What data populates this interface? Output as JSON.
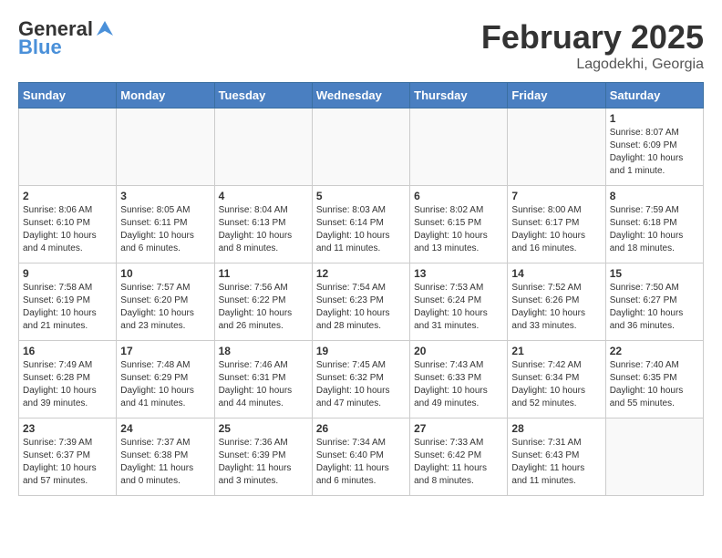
{
  "header": {
    "logo_line1": "General",
    "logo_line2": "Blue",
    "month": "February 2025",
    "location": "Lagodekhi, Georgia"
  },
  "weekdays": [
    "Sunday",
    "Monday",
    "Tuesday",
    "Wednesday",
    "Thursday",
    "Friday",
    "Saturday"
  ],
  "weeks": [
    [
      {
        "day": "",
        "info": ""
      },
      {
        "day": "",
        "info": ""
      },
      {
        "day": "",
        "info": ""
      },
      {
        "day": "",
        "info": ""
      },
      {
        "day": "",
        "info": ""
      },
      {
        "day": "",
        "info": ""
      },
      {
        "day": "1",
        "info": "Sunrise: 8:07 AM\nSunset: 6:09 PM\nDaylight: 10 hours and 1 minute."
      }
    ],
    [
      {
        "day": "2",
        "info": "Sunrise: 8:06 AM\nSunset: 6:10 PM\nDaylight: 10 hours and 4 minutes."
      },
      {
        "day": "3",
        "info": "Sunrise: 8:05 AM\nSunset: 6:11 PM\nDaylight: 10 hours and 6 minutes."
      },
      {
        "day": "4",
        "info": "Sunrise: 8:04 AM\nSunset: 6:13 PM\nDaylight: 10 hours and 8 minutes."
      },
      {
        "day": "5",
        "info": "Sunrise: 8:03 AM\nSunset: 6:14 PM\nDaylight: 10 hours and 11 minutes."
      },
      {
        "day": "6",
        "info": "Sunrise: 8:02 AM\nSunset: 6:15 PM\nDaylight: 10 hours and 13 minutes."
      },
      {
        "day": "7",
        "info": "Sunrise: 8:00 AM\nSunset: 6:17 PM\nDaylight: 10 hours and 16 minutes."
      },
      {
        "day": "8",
        "info": "Sunrise: 7:59 AM\nSunset: 6:18 PM\nDaylight: 10 hours and 18 minutes."
      }
    ],
    [
      {
        "day": "9",
        "info": "Sunrise: 7:58 AM\nSunset: 6:19 PM\nDaylight: 10 hours and 21 minutes."
      },
      {
        "day": "10",
        "info": "Sunrise: 7:57 AM\nSunset: 6:20 PM\nDaylight: 10 hours and 23 minutes."
      },
      {
        "day": "11",
        "info": "Sunrise: 7:56 AM\nSunset: 6:22 PM\nDaylight: 10 hours and 26 minutes."
      },
      {
        "day": "12",
        "info": "Sunrise: 7:54 AM\nSunset: 6:23 PM\nDaylight: 10 hours and 28 minutes."
      },
      {
        "day": "13",
        "info": "Sunrise: 7:53 AM\nSunset: 6:24 PM\nDaylight: 10 hours and 31 minutes."
      },
      {
        "day": "14",
        "info": "Sunrise: 7:52 AM\nSunset: 6:26 PM\nDaylight: 10 hours and 33 minutes."
      },
      {
        "day": "15",
        "info": "Sunrise: 7:50 AM\nSunset: 6:27 PM\nDaylight: 10 hours and 36 minutes."
      }
    ],
    [
      {
        "day": "16",
        "info": "Sunrise: 7:49 AM\nSunset: 6:28 PM\nDaylight: 10 hours and 39 minutes."
      },
      {
        "day": "17",
        "info": "Sunrise: 7:48 AM\nSunset: 6:29 PM\nDaylight: 10 hours and 41 minutes."
      },
      {
        "day": "18",
        "info": "Sunrise: 7:46 AM\nSunset: 6:31 PM\nDaylight: 10 hours and 44 minutes."
      },
      {
        "day": "19",
        "info": "Sunrise: 7:45 AM\nSunset: 6:32 PM\nDaylight: 10 hours and 47 minutes."
      },
      {
        "day": "20",
        "info": "Sunrise: 7:43 AM\nSunset: 6:33 PM\nDaylight: 10 hours and 49 minutes."
      },
      {
        "day": "21",
        "info": "Sunrise: 7:42 AM\nSunset: 6:34 PM\nDaylight: 10 hours and 52 minutes."
      },
      {
        "day": "22",
        "info": "Sunrise: 7:40 AM\nSunset: 6:35 PM\nDaylight: 10 hours and 55 minutes."
      }
    ],
    [
      {
        "day": "23",
        "info": "Sunrise: 7:39 AM\nSunset: 6:37 PM\nDaylight: 10 hours and 57 minutes."
      },
      {
        "day": "24",
        "info": "Sunrise: 7:37 AM\nSunset: 6:38 PM\nDaylight: 11 hours and 0 minutes."
      },
      {
        "day": "25",
        "info": "Sunrise: 7:36 AM\nSunset: 6:39 PM\nDaylight: 11 hours and 3 minutes."
      },
      {
        "day": "26",
        "info": "Sunrise: 7:34 AM\nSunset: 6:40 PM\nDaylight: 11 hours and 6 minutes."
      },
      {
        "day": "27",
        "info": "Sunrise: 7:33 AM\nSunset: 6:42 PM\nDaylight: 11 hours and 8 minutes."
      },
      {
        "day": "28",
        "info": "Sunrise: 7:31 AM\nSunset: 6:43 PM\nDaylight: 11 hours and 11 minutes."
      },
      {
        "day": "",
        "info": ""
      }
    ]
  ]
}
